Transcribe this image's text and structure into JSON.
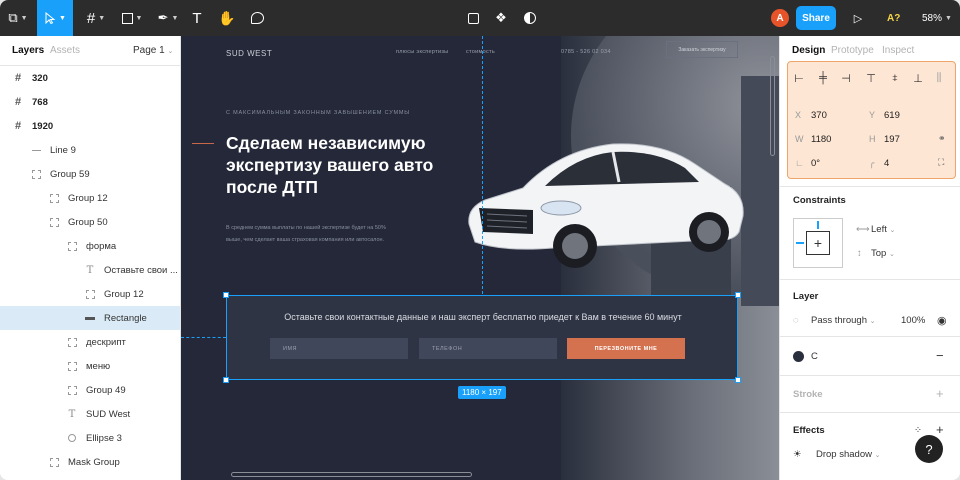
{
  "toolbar": {
    "tools": [
      {
        "name": "figma-menu-icon",
        "glyph": "⧉"
      },
      {
        "name": "move-tool-icon",
        "glyph": "➤"
      },
      {
        "name": "frame-tool-icon",
        "glyph": "#"
      },
      {
        "name": "shape-tool-icon",
        "glyph": "□"
      },
      {
        "name": "pen-tool-icon",
        "glyph": "✒"
      },
      {
        "name": "text-tool-icon",
        "glyph": "T"
      },
      {
        "name": "hand-tool-icon",
        "glyph": "✋"
      },
      {
        "name": "comment-tool-icon",
        "glyph": "◯"
      }
    ],
    "center_icons": [
      "crop-icon",
      "components-icon",
      "mask-icon"
    ],
    "avatar_initial": "A",
    "share_label": "Share",
    "font_label": "A?",
    "zoom": "58%",
    "accent": "#18a0fb"
  },
  "left_panel": {
    "tabs": {
      "layers": "Layers",
      "assets": "Assets"
    },
    "page": "Page 1",
    "layers": [
      {
        "label": "320",
        "icon": "frame",
        "indent": 0,
        "bold": true
      },
      {
        "label": "768",
        "icon": "frame",
        "indent": 0,
        "bold": true
      },
      {
        "label": "1920",
        "icon": "frame",
        "indent": 0,
        "bold": true
      },
      {
        "label": "Line 9",
        "icon": "line",
        "indent": 1
      },
      {
        "label": "Group 59",
        "icon": "group",
        "indent": 1
      },
      {
        "label": "Group 12",
        "icon": "group",
        "indent": 2
      },
      {
        "label": "Group 50",
        "icon": "group",
        "indent": 2
      },
      {
        "label": "форма",
        "icon": "group",
        "indent": 3
      },
      {
        "label": "Оставьте свои ...",
        "icon": "text",
        "indent": 4
      },
      {
        "label": "Group 12",
        "icon": "group",
        "indent": 4
      },
      {
        "label": "Rectangle",
        "icon": "rect",
        "indent": 4,
        "selected": true
      },
      {
        "label": "дескрипт",
        "icon": "group",
        "indent": 3
      },
      {
        "label": "меню",
        "icon": "group",
        "indent": 3
      },
      {
        "label": "Group 49",
        "icon": "group",
        "indent": 3
      },
      {
        "label": "SUD West",
        "icon": "text",
        "indent": 3
      },
      {
        "label": "Ellipse 3",
        "icon": "ellipse",
        "indent": 3
      },
      {
        "label": "Mask Group",
        "icon": "group",
        "indent": 2
      }
    ]
  },
  "canvas": {
    "logo": "SUD WEST",
    "nav": [
      "плюсы экспертизы",
      "стоимость"
    ],
    "phone": "0785 - 526 02 034",
    "nav_button": "Заказать экспертизу",
    "pre_title": "С МАКСИМАЛЬНЫМ ЗАКОННЫМ ЗАВЫШЕНИЕМ СУММЫ",
    "hero_title": "Сделаем независимую экспертизу вашего авто после ДТП",
    "hero_desc": "В среднем сумма выплаты по нашей экспертизе будет на 50% выше, чем сделает ваша страховая компания или автосалон.",
    "form": {
      "title": "Оставьте свои контактные данные и наш эксперт бесплатно приедет к Вам в течение 60 минут",
      "name_placeholder": "ИМЯ",
      "phone_placeholder": "ТЕЛЕФОН",
      "submit": "ПЕРЕЗВОНИТЕ МНЕ"
    },
    "selection_size": "1180 × 197"
  },
  "right_panel": {
    "tabs": {
      "design": "Design",
      "prototype": "Prototype",
      "inspect": "Inspect"
    },
    "align_icons": [
      "align-left-icon",
      "align-center-h-icon",
      "align-right-icon",
      "align-top-icon",
      "align-center-v-icon",
      "align-bottom-icon",
      "distribute-icon"
    ],
    "props": {
      "x_label": "X",
      "x": "370",
      "y_label": "Y",
      "y": "619",
      "w_label": "W",
      "w": "1180",
      "h_label": "H",
      "h": "197",
      "rotation": "0°",
      "radius": "4"
    },
    "constraints": {
      "title": "Constraints",
      "horizontal": "Left",
      "vertical": "Top"
    },
    "layer": {
      "title": "Layer",
      "blend": "Pass through",
      "opacity": "100%"
    },
    "fill": {
      "label": "C",
      "color": "#2a2f3d"
    },
    "stroke": {
      "title": "Stroke"
    },
    "effects": {
      "title": "Effects",
      "effect": "Drop shadow"
    },
    "help": "?"
  }
}
